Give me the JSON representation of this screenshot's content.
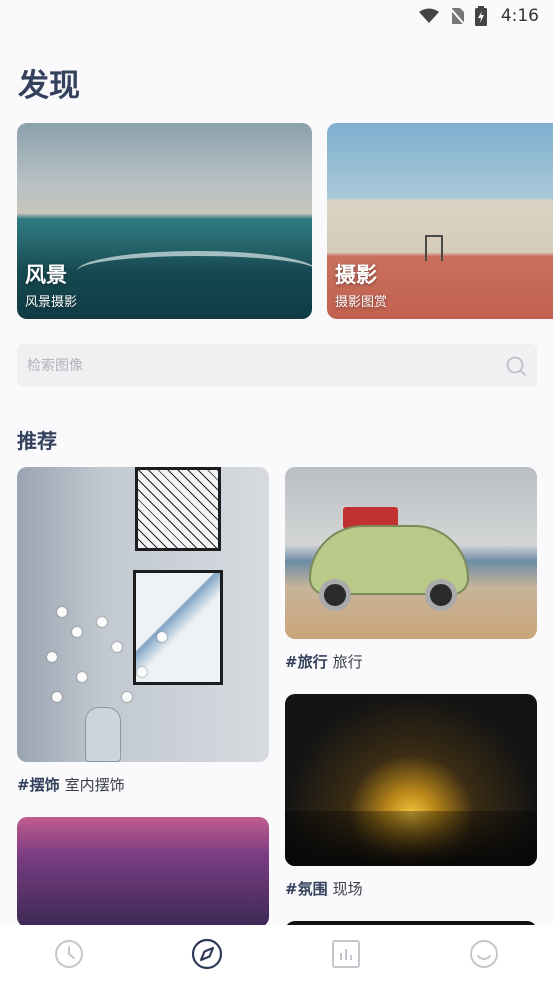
{
  "status_bar": {
    "time": "4:16"
  },
  "page_title": "发现",
  "categories": [
    {
      "title": "风景",
      "subtitle": "风景摄影"
    },
    {
      "title": "摄影",
      "subtitle": "摄影图赏"
    }
  ],
  "search": {
    "placeholder": "检索图像"
  },
  "recommend": {
    "title": "推荐",
    "items": [
      {
        "tag": "#摆饰",
        "text": "室内摆饰"
      },
      {
        "tag": "#旅行",
        "text": "旅行"
      },
      {
        "tag": "#氛围",
        "text": "现场"
      }
    ]
  },
  "tabs": [
    {
      "icon": "clock-icon",
      "active": false
    },
    {
      "icon": "compass-icon",
      "active": true
    },
    {
      "icon": "chart-icon",
      "active": false
    },
    {
      "icon": "smile-icon",
      "active": false
    }
  ],
  "colors": {
    "active_tab": "#2f3b56",
    "inactive_tab": "#c3c7cd",
    "title": "#33415c"
  }
}
